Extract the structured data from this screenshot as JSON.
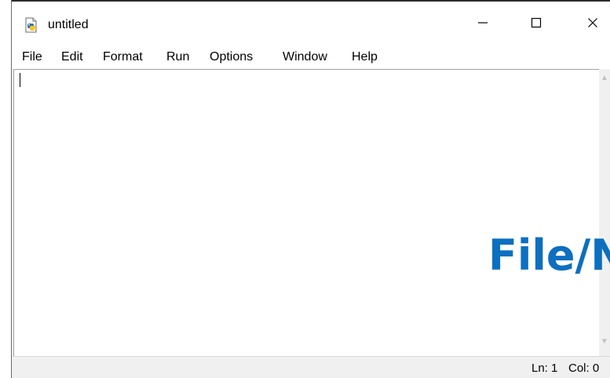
{
  "window": {
    "title": "untitled",
    "icons": {
      "app": "idle-python-file-icon",
      "minimize": "minimize-icon",
      "maximize": "maximize-icon",
      "close": "close-icon"
    }
  },
  "menu": {
    "items": [
      "File",
      "Edit",
      "Format",
      "Run",
      "Options",
      "Window",
      "Help"
    ]
  },
  "editor": {
    "content": ""
  },
  "status": {
    "line": "Ln: 1",
    "col": "Col: 0"
  },
  "overlay": {
    "text": "File/New"
  },
  "colors": {
    "overlay": "#0c6fc0",
    "statusbar": "#f0f0f0"
  }
}
